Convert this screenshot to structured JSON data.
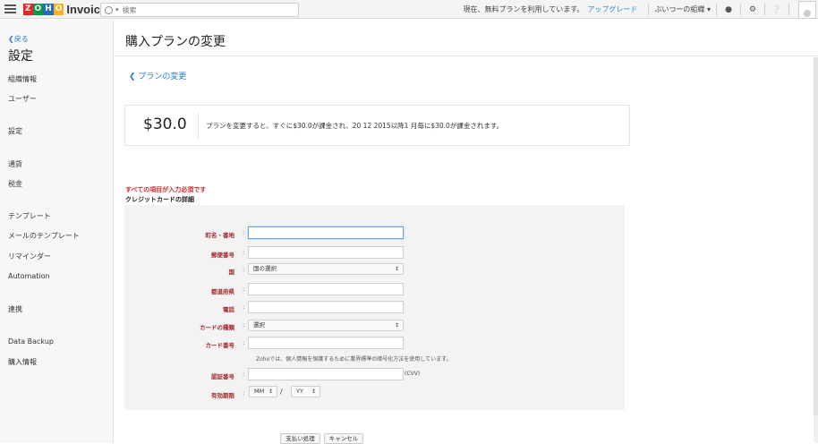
{
  "header": {
    "app_name": "Invoice",
    "logo_letters": [
      "Z",
      "O",
      "H",
      "O"
    ],
    "logo_colors": [
      "#e42527",
      "#089949",
      "#226db4",
      "#f9b21d"
    ],
    "search_placeholder": "検索",
    "plan_text": "現在、無料プランを利用しています。",
    "upgrade_label": "アップグレード",
    "org_label": "ぶいつーの組織 ▾"
  },
  "sidebar": {
    "back_label": "❮戻る",
    "title": "設定",
    "items": [
      "組織情報",
      "ユーザー",
      "設定",
      "通貨",
      "税金",
      "テンプレート",
      "メールのテンプレート",
      "リマインダー",
      "Automation",
      "連携",
      "Data Backup",
      "購入情報"
    ]
  },
  "main": {
    "title": "購入プランの変更",
    "breadcrumb": "❮ プランの変更",
    "price": "$30.0",
    "price_note": "プランを変更すると、すぐに$30.0が課金され、20 12 2015以降1 月毎に$30.0が課金されます。",
    "required_note": "すべての項目が入力必須です",
    "section_title": "クレジットカードの詳細"
  },
  "form": {
    "street_label": "町名・番地",
    "zip_label": "郵便番号",
    "country_label": "国",
    "country_value": "国の選択",
    "state_label": "都道府県",
    "phone_label": "電話",
    "card_type_label": "カードの種類",
    "card_type_value": "選択",
    "card_number_label": "カード番号",
    "security_note": "Zohoでは、個人情報を保護するために業界標準の暗号化方法を使用しています。",
    "cvv_label": "認証番号",
    "cvv_suffix": "(CVV)",
    "expiry_label": "有効期限",
    "month_value": "MM",
    "year_value": "YY",
    "separator": "/",
    "colon": ":"
  },
  "buttons": {
    "pay": "支払い処理",
    "cancel": "キャンセル"
  },
  "colors": {
    "link": "#2a7ad2",
    "required": "#d8272b",
    "label": "#a3282b"
  }
}
